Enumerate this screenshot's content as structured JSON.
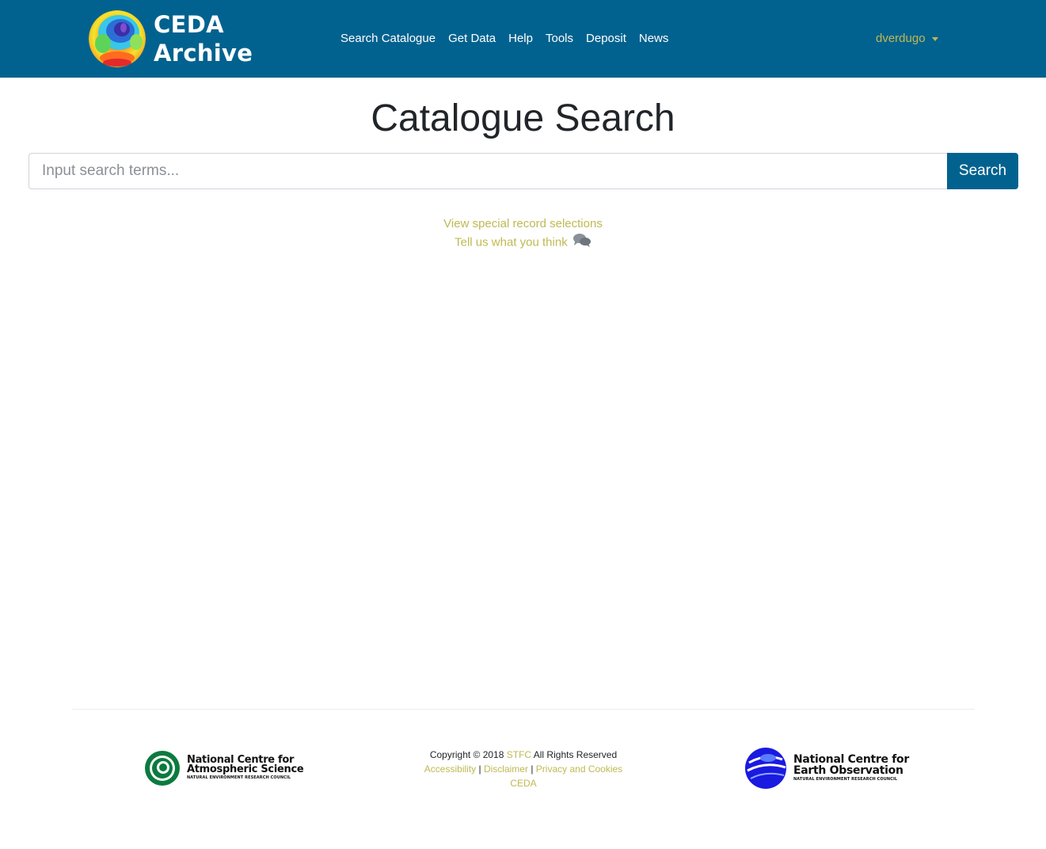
{
  "header": {
    "brand_line1": "CEDA",
    "brand_line2": "Archive",
    "nav": [
      {
        "label": "Search Catalogue"
      },
      {
        "label": "Get Data"
      },
      {
        "label": "Help"
      },
      {
        "label": "Tools"
      },
      {
        "label": "Deposit"
      },
      {
        "label": "News"
      }
    ],
    "user": "dverdugo"
  },
  "main": {
    "title": "Catalogue Search",
    "search_placeholder": "Input search terms...",
    "search_button": "Search",
    "link_special": "View special record selections",
    "link_feedback": "Tell us what you think"
  },
  "footer": {
    "ncas": {
      "line1": "National Centre for",
      "line2": "Atmospheric Science",
      "line3": "NATURAL ENVIRONMENT RESEARCH COUNCIL"
    },
    "nceo": {
      "line1": "National Centre for",
      "line2": "Earth Observation",
      "line3": "NATURAL ENVIRONMENT RESEARCH COUNCIL"
    },
    "copyright_prefix": "Copyright © 2018",
    "copyright_org": "STFC",
    "copyright_suffix": "All Rights Reserved",
    "accessibility": "Accessibility",
    "disclaimer": "Disclaimer",
    "privacy": "Privacy and Cookies",
    "separator": "|",
    "ceda": "CEDA"
  },
  "colors": {
    "navbar": "#02628f",
    "link": "#bfb952",
    "button": "#02628f"
  }
}
